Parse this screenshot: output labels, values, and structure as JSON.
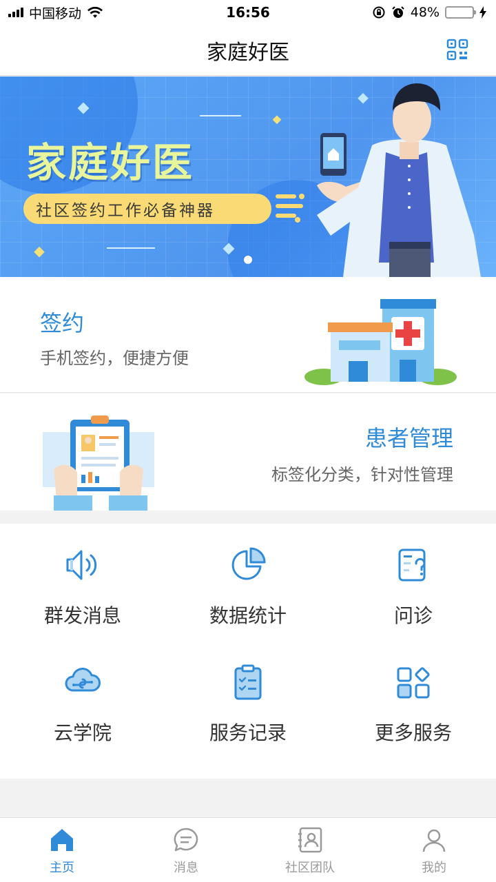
{
  "status": {
    "carrier": "中国移动",
    "time": "16:56",
    "battery": "48%"
  },
  "nav": {
    "title": "家庭好医"
  },
  "banner": {
    "title": "家庭好医",
    "slogan": "社区签约工作必备神器"
  },
  "sign_card": {
    "title": "签约",
    "subtitle": "手机签约，便捷方便"
  },
  "patient_card": {
    "title": "患者管理",
    "subtitle": "标签化分类，针对性管理"
  },
  "grid": {
    "items": [
      {
        "label": "群发消息",
        "icon": "speaker-icon"
      },
      {
        "label": "数据统计",
        "icon": "pie-chart-icon"
      },
      {
        "label": "问诊",
        "icon": "inquiry-doc-icon"
      },
      {
        "label": "云学院",
        "icon": "cloud-icon"
      },
      {
        "label": "服务记录",
        "icon": "clipboard-icon"
      },
      {
        "label": "更多服务",
        "icon": "more-apps-icon"
      }
    ]
  },
  "tabs": [
    {
      "label": "主页",
      "icon": "home-icon",
      "active": true
    },
    {
      "label": "消息",
      "icon": "message-icon",
      "active": false
    },
    {
      "label": "社区团队",
      "icon": "contacts-icon",
      "active": false
    },
    {
      "label": "我的",
      "icon": "user-icon",
      "active": false
    }
  ],
  "colors": {
    "accent": "#2f8ad8",
    "banner": "#5ea9f7",
    "pill": "#f9da74"
  }
}
